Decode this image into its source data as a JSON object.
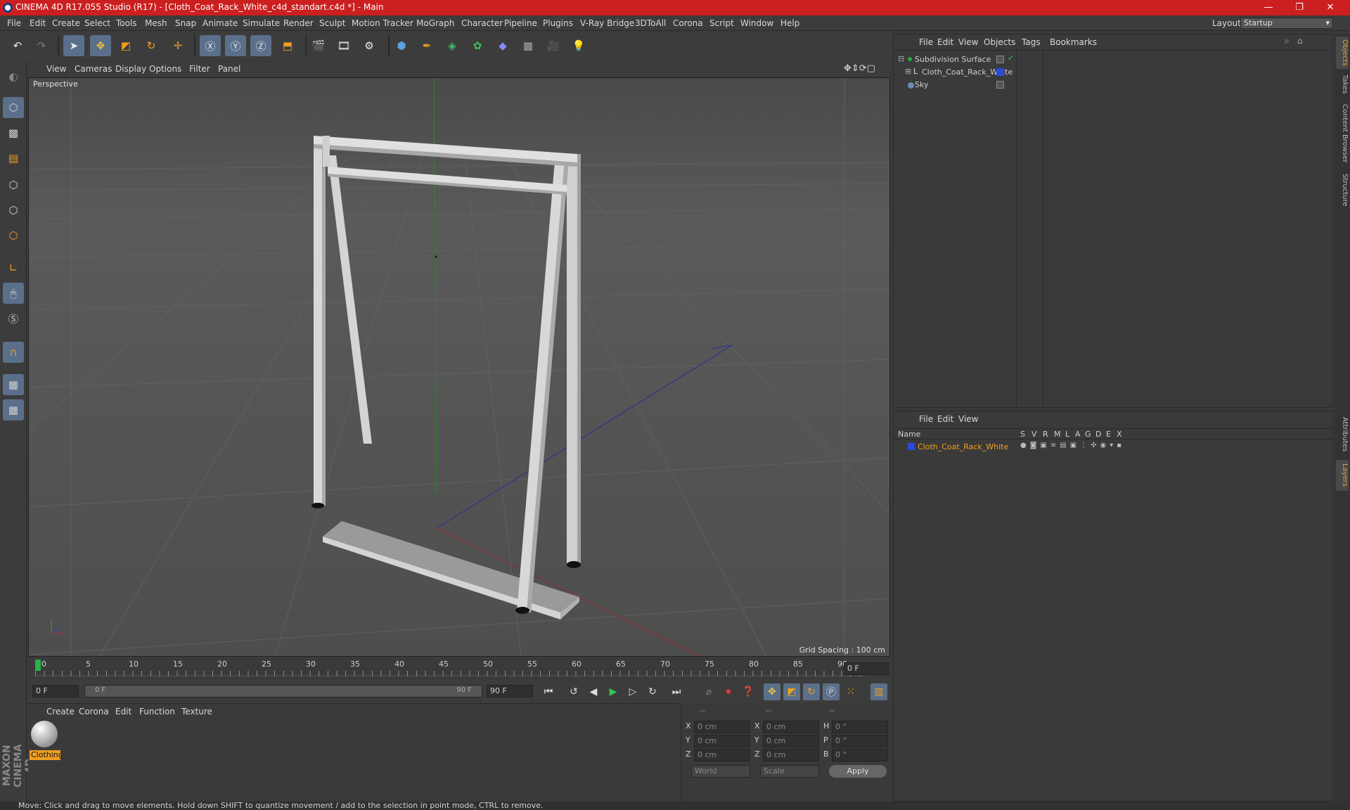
{
  "window": {
    "title": "CINEMA 4D R17.055 Studio (R17) - [Cloth_Coat_Rack_White_c4d_standart.c4d *] - Main",
    "min": "—",
    "max": "❐",
    "close": "✕"
  },
  "menu": [
    "File",
    "Edit",
    "Create",
    "Select",
    "Tools",
    "Mesh",
    "Snap",
    "Animate",
    "Simulate",
    "Render",
    "Sculpt",
    "Motion Tracker",
    "MoGraph",
    "Character",
    "Pipeline",
    "Plugins",
    "V-Ray Bridge",
    "3DToAll",
    "Corona",
    "Script",
    "Window",
    "Help"
  ],
  "layout": {
    "label": "Layout:",
    "value": "Startup"
  },
  "viewport": {
    "menu": [
      "View",
      "Cameras",
      "Display",
      "Options",
      "Filter",
      "Panel"
    ],
    "name": "Perspective",
    "grid_spacing": "Grid Spacing : 100 cm"
  },
  "timeline": {
    "ticks": [
      "0",
      "5",
      "10",
      "15",
      "20",
      "25",
      "30",
      "35",
      "40",
      "45",
      "50",
      "55",
      "60",
      "65",
      "70",
      "75",
      "80",
      "85",
      "90"
    ],
    "current": "0 F",
    "start": "0 F",
    "range_start": "0 F",
    "range_end": "90 F",
    "end": "90 F"
  },
  "materials": {
    "menu": [
      "Create",
      "Corona",
      "Edit",
      "Function",
      "Texture"
    ],
    "items": [
      {
        "name": "Clothing"
      }
    ]
  },
  "coords": {
    "headers": [
      "--",
      "--",
      "--"
    ],
    "rows": [
      {
        "a": "X",
        "av": "0 cm",
        "b": "X",
        "bv": "0 cm",
        "c": "H",
        "cv": "0 °"
      },
      {
        "a": "Y",
        "av": "0 cm",
        "b": "Y",
        "bv": "0 cm",
        "c": "P",
        "cv": "0 °"
      },
      {
        "a": "Z",
        "av": "0 cm",
        "b": "Z",
        "bv": "0 cm",
        "c": "B",
        "cv": "0 °"
      }
    ],
    "mode1": "World",
    "mode2": "Scale",
    "apply": "Apply"
  },
  "objects": {
    "menu": [
      "File",
      "Edit",
      "View",
      "Objects",
      "Tags",
      "Bookmarks"
    ],
    "items": [
      {
        "name": "Subdivision Surface",
        "color": "#2aa84a"
      },
      {
        "name": "Cloth_Coat_Rack_White",
        "color": "#2a4ad8"
      },
      {
        "name": "Sky",
        "color": "#6a8ab8"
      }
    ]
  },
  "layers": {
    "menu": [
      "File",
      "Edit",
      "View"
    ],
    "columns": [
      "Name",
      "S",
      "V",
      "R",
      "M",
      "L",
      "A",
      "G",
      "D",
      "E",
      "X"
    ],
    "items": [
      {
        "name": "Cloth_Coat_Rack_White",
        "color": "#2a4ad8"
      }
    ]
  },
  "right_tabs": [
    "Objects",
    "Takes",
    "Content Browser",
    "Structure",
    "Attributes",
    "Layers"
  ],
  "brand": "MAXON CINEMA 4D",
  "status": "Move: Click and drag to move elements. Hold down SHIFT to quantize movement / add to the selection in point mode, CTRL to remove."
}
